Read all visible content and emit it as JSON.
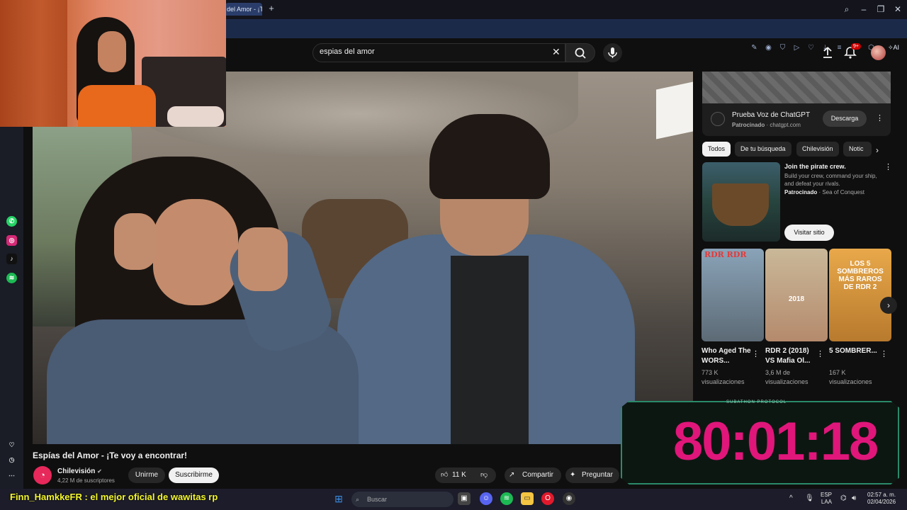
{
  "browser": {
    "tab_title": "del Amor - ¡T",
    "new_tab": "+",
    "ai_label": "AI"
  },
  "search": {
    "query": "espias del amor"
  },
  "header": {
    "notifications_badge": "9+"
  },
  "video": {
    "title": "Espías del Amor - ¡Te voy a encontrar!",
    "channel": "Chilevisión",
    "subscribers": "4,22 M de suscriptores",
    "join_label": "Unirme",
    "subscribe_label": "Suscribirme",
    "likes": "11 K",
    "share_label": "Compartir",
    "ask_label": "Preguntar"
  },
  "ad_top": {
    "title": "Prueba Voz de ChatGPT",
    "sponsored": "Patrocinado",
    "domain": "chatgpt.com",
    "button": "Descarga"
  },
  "chips": [
    "Todos",
    "De tu búsqueda",
    "Chilevisión",
    "Notic"
  ],
  "ad_game": {
    "title": "Join the pirate crew.",
    "description": "Build your crew, command your ship, and defeat your rivals.",
    "sponsored": "Patrocinado",
    "advertiser": "Sea of Conquest",
    "button": "Visitar sitio"
  },
  "shelf": [
    {
      "tag": "RDR  RDR",
      "title": "Who Aged The WORS...",
      "views": "773 K visualizaciones"
    },
    {
      "tag": "2018",
      "title": "RDR 2 (2018) VS Mafia Ol...",
      "views": "3,6 M de visualizaciones"
    },
    {
      "tag": "LOS 5 SOMBREROS MÁS RAROS DE RDR 2",
      "title": "5 SOMBRER...",
      "views": "167 K visualizaciones"
    }
  ],
  "overlay": {
    "timer_label": "SUBATHON PROTOCOL",
    "timer": "80:01:18",
    "chat_message": "Finn_HamkkeFR : el mejor oficial de wawitas rp"
  },
  "taskbar": {
    "search_placeholder": "Buscar",
    "lang_top": "ESP",
    "lang_bottom": "LAA",
    "time": "02:57 a. m.",
    "date": "02/04/2026"
  },
  "colors": {
    "accent_pink": "#e0167a",
    "chat_yellow": "#f4f72b",
    "browser_blue": "#1c2a4a"
  }
}
